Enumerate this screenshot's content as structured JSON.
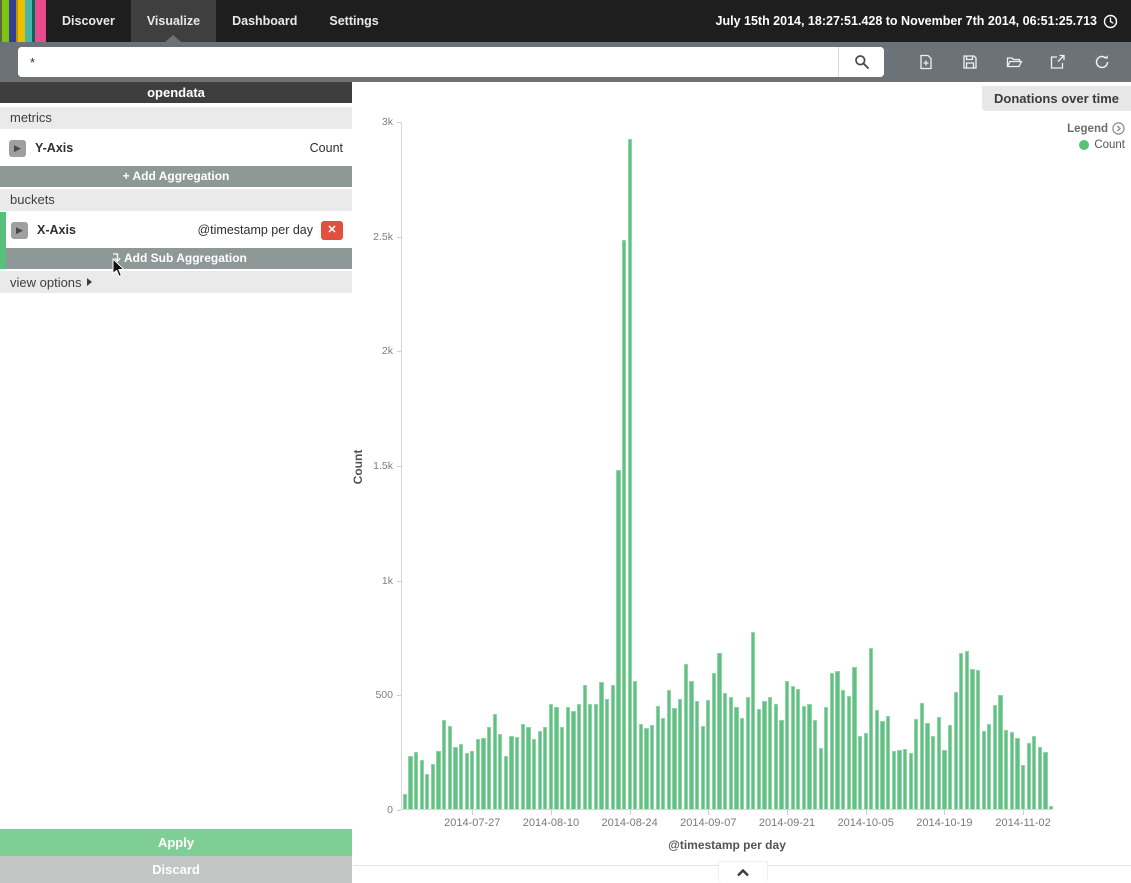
{
  "nav": {
    "items": [
      {
        "label": "Discover",
        "active": false
      },
      {
        "label": "Visualize",
        "active": true
      },
      {
        "label": "Dashboard",
        "active": false
      },
      {
        "label": "Settings",
        "active": false
      }
    ],
    "time_range": "July 15th 2014, 18:27:51.428 to November 7th 2014, 06:51:25.713"
  },
  "search": {
    "value": "*"
  },
  "toolbar": {
    "icons": [
      "new-visualization",
      "save",
      "open",
      "share",
      "refresh"
    ]
  },
  "sidebar": {
    "index_name": "opendata",
    "metrics_label": "metrics",
    "y_axis": {
      "label": "Y-Axis",
      "value": "Count"
    },
    "add_aggregation_label": "+ Add Aggregation",
    "buckets_label": "buckets",
    "x_axis": {
      "label": "X-Axis",
      "value": "@timestamp per day"
    },
    "add_sub_aggregation_label": "Add Sub Aggregation",
    "view_options_label": "view options",
    "apply_label": "Apply",
    "discard_label": "Discard"
  },
  "main": {
    "title": "Donations over time",
    "legend": {
      "label": "Legend",
      "items": [
        {
          "label": "Count",
          "color": "#57c17b"
        }
      ]
    }
  },
  "colors": {
    "bar_fill": "#5fc283",
    "bar_border": "#92d4a8",
    "apply_green": "#7fce96",
    "delete_red": "#e1503d",
    "sidebar_button_gray": "#8e9897",
    "legend_dot_green": "#57c17b"
  },
  "chart_data": {
    "type": "bar",
    "title": "Donations over time",
    "xlabel": "@timestamp per day",
    "ylabel": "Count",
    "ylim": [
      0,
      3000
    ],
    "grid": false,
    "legend_position": "right",
    "x_start_date": "2014-07-15",
    "x_interval": "1 day",
    "yticks": [
      {
        "label": "0",
        "value": 0
      },
      {
        "label": "500",
        "value": 500
      },
      {
        "label": "1k",
        "value": 1000
      },
      {
        "label": "1.5k",
        "value": 1500
      },
      {
        "label": "2k",
        "value": 2000
      },
      {
        "label": "2.5k",
        "value": 2500
      },
      {
        "label": "3k",
        "value": 3000
      }
    ],
    "xticks": [
      {
        "label": "2014-07-27",
        "index": 12
      },
      {
        "label": "2014-08-10",
        "index": 26
      },
      {
        "label": "2014-08-24",
        "index": 40
      },
      {
        "label": "2014-09-07",
        "index": 54
      },
      {
        "label": "2014-09-21",
        "index": 68
      },
      {
        "label": "2014-10-05",
        "index": 82
      },
      {
        "label": "2014-10-19",
        "index": 96
      },
      {
        "label": "2014-11-02",
        "index": 110
      }
    ],
    "series": [
      {
        "name": "Count",
        "color": "#5fc283",
        "border_color": "#92d4a8",
        "values": [
          65,
          233,
          247,
          215,
          153,
          196,
          254,
          388,
          364,
          270,
          284,
          243,
          252,
          306,
          310,
          357,
          414,
          325,
          229,
          320,
          313,
          371,
          357,
          304,
          342,
          359,
          458,
          446,
          357,
          443,
          429,
          458,
          539,
          458,
          458,
          552,
          480,
          540,
          1480,
          2480,
          2920,
          560,
          370,
          355,
          365,
          450,
          395,
          517,
          440,
          480,
          634,
          560,
          470,
          360,
          475,
          593,
          680,
          505,
          490,
          445,
          395,
          490,
          772,
          437,
          470,
          489,
          459,
          390,
          560,
          537,
          525,
          450,
          457,
          390,
          266,
          444,
          595,
          600,
          517,
          494,
          619,
          320,
          331,
          702,
          433,
          382,
          404,
          251,
          256,
          262,
          244,
          392,
          462,
          375,
          320,
          401,
          259,
          368,
          509,
          680,
          690,
          611,
          608,
          339,
          372,
          455,
          499,
          346,
          334,
          310,
          193,
          288,
          320,
          270,
          250,
          12
        ]
      }
    ]
  }
}
